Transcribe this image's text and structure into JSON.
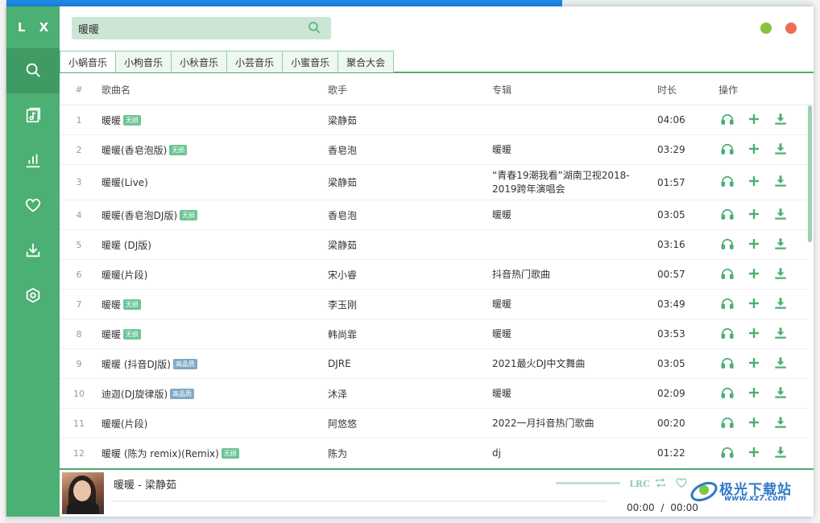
{
  "app": {
    "logo": "L X"
  },
  "colors": {
    "accent": "#4caf73",
    "accent_dark": "#3f9b63",
    "search_bg": "#cbe6d5",
    "badge_lossless": "#6bc595",
    "badge_hq": "#7fa9c6",
    "min_btn": "#85c43c",
    "close_btn": "#ee6d54"
  },
  "sidebar": {
    "items": [
      {
        "name": "search",
        "icon": "search-icon",
        "active": true
      },
      {
        "name": "songlist",
        "icon": "music-list-icon",
        "active": false
      },
      {
        "name": "leaderboard",
        "icon": "bar-chart-icon",
        "active": false
      },
      {
        "name": "favorites",
        "icon": "heart-icon",
        "active": false
      },
      {
        "name": "download",
        "icon": "download-icon",
        "active": false
      },
      {
        "name": "settings",
        "icon": "settings-icon",
        "active": false
      }
    ]
  },
  "search": {
    "value": "暖暖",
    "placeholder": ""
  },
  "tabs": [
    {
      "label": "小蜗音乐",
      "active": true
    },
    {
      "label": "小枸音乐",
      "active": false
    },
    {
      "label": "小秋音乐",
      "active": false
    },
    {
      "label": "小芸音乐",
      "active": false
    },
    {
      "label": "小蜜音乐",
      "active": false
    },
    {
      "label": "聚合大会",
      "active": false
    }
  ],
  "table": {
    "headers": {
      "num": "#",
      "name": "歌曲名",
      "singer": "歌手",
      "album": "专辑",
      "duration": "时长",
      "ops": "操作"
    },
    "rows": [
      {
        "num": "1",
        "name": "暖暖",
        "badge": "无损",
        "badge_type": "ls",
        "singer": "梁静茹",
        "album": "",
        "duration": "04:06"
      },
      {
        "num": "2",
        "name": "暖暖(香皂泡版)",
        "badge": "无损",
        "badge_type": "ls",
        "singer": "香皂泡",
        "album": "暖暖",
        "duration": "03:29"
      },
      {
        "num": "3",
        "name": "暖暖(Live)",
        "badge": "",
        "badge_type": "",
        "singer": "梁静茹",
        "album": "“青春19潮我看”湖南卫视2018-2019跨年演唱会",
        "duration": "01:57"
      },
      {
        "num": "4",
        "name": "暖暖(香皂泡DJ版)",
        "badge": "无损",
        "badge_type": "ls",
        "singer": "香皂泡",
        "album": "暖暖",
        "duration": "03:05"
      },
      {
        "num": "5",
        "name": "暖暖 (DJ版)",
        "badge": "",
        "badge_type": "",
        "singer": "梁静茹",
        "album": "",
        "duration": "03:16"
      },
      {
        "num": "6",
        "name": "暖暖(片段)",
        "badge": "",
        "badge_type": "",
        "singer": "宋小睿",
        "album": "抖音热门歌曲",
        "duration": "00:57"
      },
      {
        "num": "7",
        "name": "暖暖",
        "badge": "无损",
        "badge_type": "ls",
        "singer": "李玉刚",
        "album": "暖暖",
        "duration": "03:49"
      },
      {
        "num": "8",
        "name": "暖暖",
        "badge": "无损",
        "badge_type": "ls",
        "singer": "韩尚霏",
        "album": "暖暖",
        "duration": "03:53"
      },
      {
        "num": "9",
        "name": "暖暖 (抖音DJ版)",
        "badge": "高品质",
        "badge_type": "hq",
        "singer": "DJRE",
        "album": "2021最火DJ中文舞曲",
        "duration": "03:05"
      },
      {
        "num": "10",
        "name": "迪迦(DJ旋律版)",
        "badge": "高品质",
        "badge_type": "hq",
        "singer": "沐泽",
        "album": "暖暖",
        "duration": "02:09"
      },
      {
        "num": "11",
        "name": "暖暖(片段)",
        "badge": "",
        "badge_type": "",
        "singer": "阿悠悠",
        "album": "2022一月抖音热门歌曲",
        "duration": "00:20"
      },
      {
        "num": "12",
        "name": "暖暖 (陈为 remix)(Remix)",
        "badge": "无损",
        "badge_type": "ls",
        "singer": "陈为",
        "album": "dj",
        "duration": "01:22"
      }
    ]
  },
  "player": {
    "title": "暖暖 - 梁静茹",
    "lrc_label": "LRC",
    "current_time": "00:00",
    "separator": "/",
    "total_time": "00:00",
    "progress": 0
  },
  "watermark": {
    "text": "极光下载站",
    "url": "www.xz7.com"
  }
}
